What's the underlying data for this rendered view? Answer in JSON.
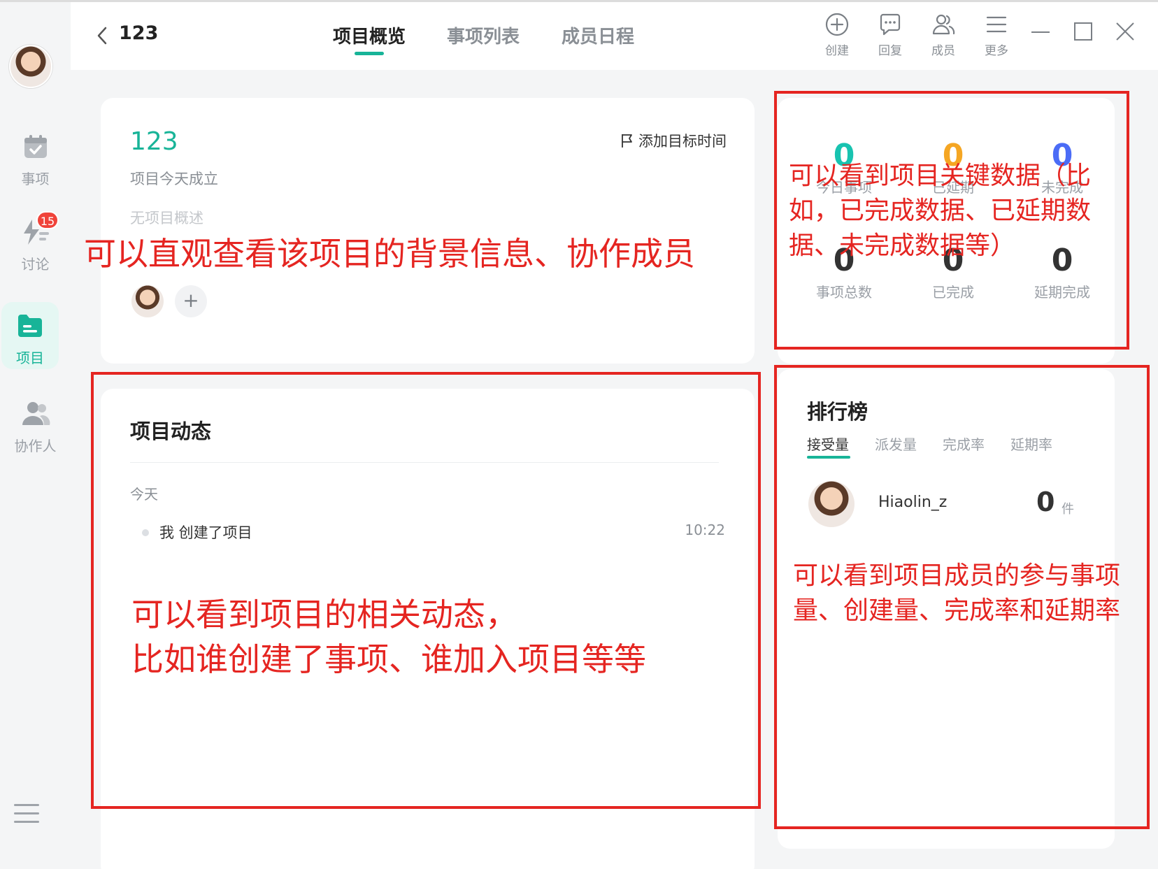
{
  "sidebar": {
    "items": [
      {
        "label": "事项"
      },
      {
        "label": "讨论",
        "badge": "15"
      },
      {
        "label": "项目"
      },
      {
        "label": "协作人"
      }
    ]
  },
  "header": {
    "project_name": "123",
    "tabs": [
      {
        "label": "项目概览"
      },
      {
        "label": "事项列表"
      },
      {
        "label": "成员日程"
      }
    ],
    "tools": [
      {
        "label": "创建"
      },
      {
        "label": "回复"
      },
      {
        "label": "成员"
      },
      {
        "label": "更多"
      }
    ]
  },
  "info": {
    "title": "123",
    "subtitle": "项目今天成立",
    "description": "无项目概述",
    "target_button": "添加目标时间",
    "add_member": "+"
  },
  "stats": [
    {
      "value": "0",
      "label": "今日事项",
      "color": "#18c3b0"
    },
    {
      "value": "0",
      "label": "已延期",
      "color": "#f5a623"
    },
    {
      "value": "0",
      "label": "未完成",
      "color": "#4b6cf6"
    },
    {
      "value": "0",
      "label": "事项总数",
      "color": "#333333"
    },
    {
      "value": "0",
      "label": "已完成",
      "color": "#333333"
    },
    {
      "value": "0",
      "label": "延期完成",
      "color": "#333333"
    }
  ],
  "activity": {
    "title": "项目动态",
    "day": "今天",
    "items": [
      {
        "text": "我 创建了项目",
        "time": "10:22"
      }
    ]
  },
  "ranking": {
    "title": "排行榜",
    "tabs": [
      {
        "label": "接受量"
      },
      {
        "label": "派发量"
      },
      {
        "label": "完成率"
      },
      {
        "label": "延期率"
      }
    ],
    "rows": [
      {
        "name": "Hiaolin_z",
        "count": "0",
        "unit": "件"
      }
    ]
  },
  "annotations": {
    "info": "可以直观查看该项目的背景信息、协作成员",
    "stats_line1": "可以看到项目关键数据（比",
    "stats_line2": "如，已完成数据、已延期数",
    "stats_line3": "据、未完成数据等）",
    "activity_line1": "可以看到项目的相关动态，",
    "activity_line2": "比如谁创建了事项、谁加入项目等等",
    "ranking_line1": "可以看到项目成员的参与事项",
    "ranking_line2": "量、创建量、完成率和延期率"
  },
  "colors": {
    "accent": "#18b498",
    "annotation": "#e52521",
    "badge": "#f0433a"
  }
}
